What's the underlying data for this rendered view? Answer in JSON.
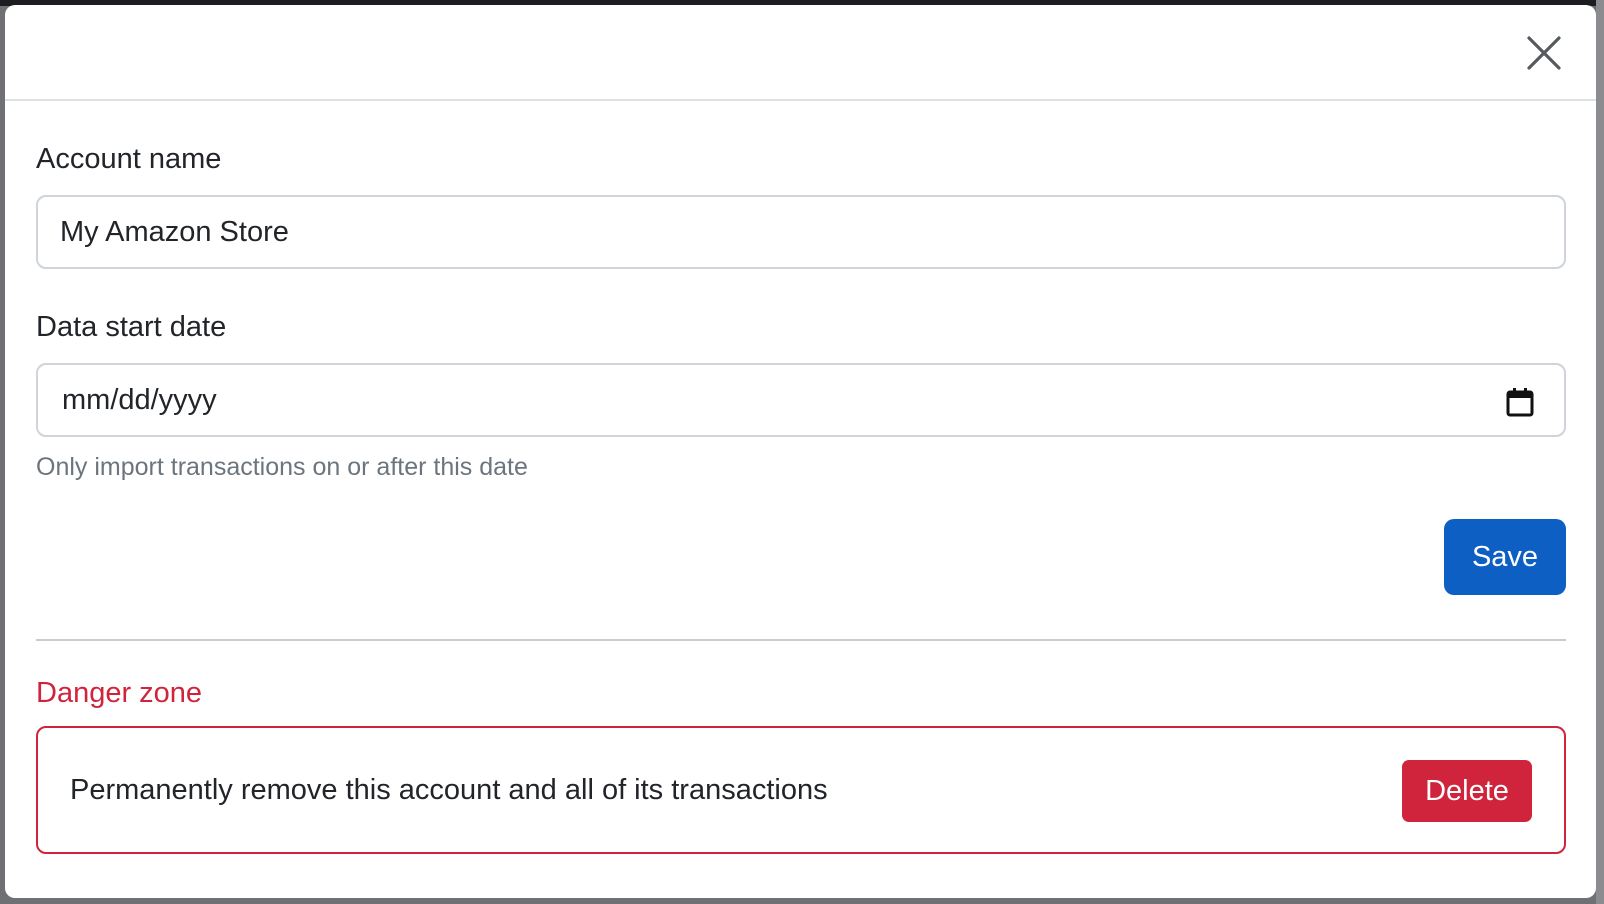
{
  "modal": {
    "close_icon": "close-icon"
  },
  "form": {
    "account_name_label": "Account name",
    "account_name_value": "My Amazon Store",
    "start_date_label": "Data start date",
    "start_date_placeholder": "mm/dd/yyyy",
    "start_date_icon": "calendar-icon",
    "start_date_help": "Only import transactions on or after this date",
    "save_label": "Save"
  },
  "danger_zone": {
    "title": "Danger zone",
    "description": "Permanently remove this account and all of its transactions",
    "delete_label": "Delete"
  },
  "colors": {
    "primary": "#0d5fc4",
    "danger": "#d0243c",
    "muted_text": "#6c757d",
    "border": "#ced4da"
  }
}
